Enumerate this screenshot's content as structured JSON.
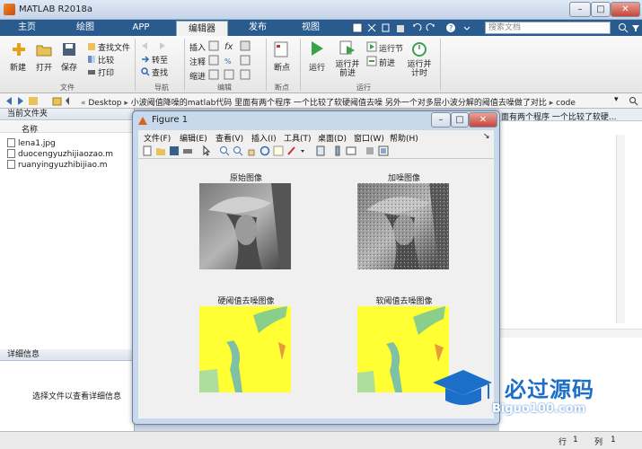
{
  "app": {
    "title": "MATLAB R2018a"
  },
  "tabs": [
    {
      "label": "主页"
    },
    {
      "label": "绘图"
    },
    {
      "label": "APP"
    },
    {
      "label": "编辑器"
    },
    {
      "label": "发布"
    },
    {
      "label": "视图"
    }
  ],
  "search": {
    "placeholder": "搜索文档"
  },
  "ribbon": {
    "file": {
      "new": "新建",
      "open": "打开",
      "save": "保存",
      "find_files": "查找文件",
      "compare": "比较",
      "print": "打印",
      "section": "文件"
    },
    "nav": {
      "goto": "转至",
      "find": "查找",
      "section": "导航"
    },
    "edit": {
      "insert": "插入",
      "comment": "注释",
      "indent": "缩进",
      "section": "编辑"
    },
    "breakpoints": {
      "label": "断点",
      "section": "断点"
    },
    "run": {
      "run": "运行",
      "run_advance": "运行并\n前进",
      "run_section": "运行节",
      "advance": "前进",
      "run_time": "运行并\n计时",
      "section": "运行"
    }
  },
  "address": {
    "segments": [
      "Desktop",
      "小波阈值降噪的matlab代码 里面有两个程序 一个比较了软硬阈值去噪 另外一个对多层小波分解的阈值去噪做了对比",
      "code"
    ]
  },
  "left_panel": {
    "title": "当前文件夹",
    "column": "名称",
    "files": [
      "lena1.jpg",
      "duocengyuzhijiaozao.m",
      "ruanyingyuzhibijiao.m"
    ],
    "details_title": "详细信息",
    "details_hint": "选择文件以查看详细信息"
  },
  "right_panel": {
    "path_text": "面有两个程序 一个比较了软硬..."
  },
  "status": {
    "row_label": "行",
    "row": "1",
    "col_label": "列",
    "col": "1"
  },
  "figure": {
    "title": "Figure 1",
    "menu": [
      "文件(F)",
      "编辑(E)",
      "查看(V)",
      "插入(I)",
      "工具(T)",
      "桌面(D)",
      "窗口(W)",
      "帮助(H)"
    ],
    "plots": [
      {
        "title": "原始图像"
      },
      {
        "title": "加噪图像"
      },
      {
        "title": "硬阈值去噪图像"
      },
      {
        "title": "软阈值去噪图像"
      }
    ]
  },
  "watermark": {
    "text": "必过源码",
    "url": "Biguo100.com"
  },
  "colors": {
    "tab_bar": "#2a5b8f",
    "plot_yellow": "#ffff33",
    "watermark_blue": "#1b6fc8"
  }
}
